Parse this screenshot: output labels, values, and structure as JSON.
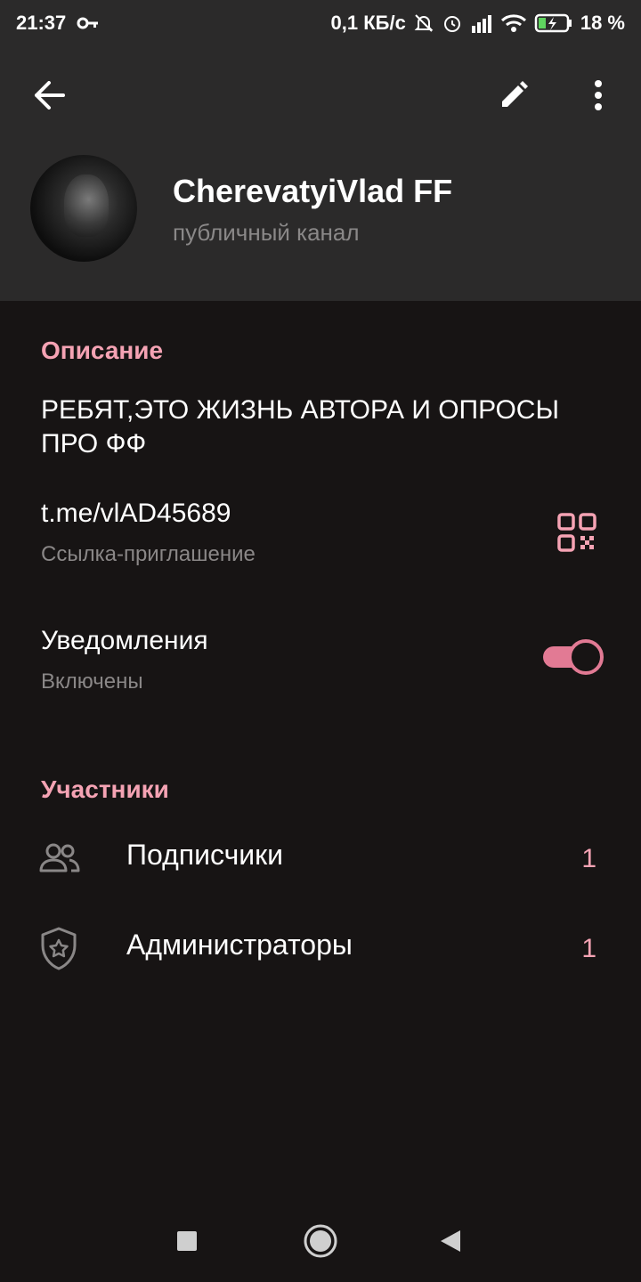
{
  "status_bar": {
    "time": "21:37",
    "speed": "0,1 КБ/с",
    "battery": "18 %",
    "icons": [
      "key-icon",
      "mute-icon",
      "alarm-icon",
      "signal-icon",
      "wifi-icon",
      "battery-icon"
    ]
  },
  "toolbar": {
    "back_icon": "arrow-left-icon",
    "edit_icon": "pencil-icon",
    "more_icon": "more-vertical-icon"
  },
  "channel": {
    "name": "CherevatyiVlad FF",
    "type": "публичный канал"
  },
  "description": {
    "title": "Описание",
    "text": "РЕБЯТ,ЭТО ЖИЗНЬ АВТОРА И ОПРОСЫ ПРО ФФ"
  },
  "invite": {
    "link": "t.me/vlAD45689",
    "label": "Ссылка-приглашение"
  },
  "notifications": {
    "title": "Уведомления",
    "status": "Включены",
    "enabled": true
  },
  "members": {
    "title": "Участники",
    "items": [
      {
        "label": "Подписчики",
        "count": "1",
        "icon": "people-icon"
      },
      {
        "label": "Администраторы",
        "count": "1",
        "icon": "shield-star-icon"
      }
    ]
  },
  "colors": {
    "accent": "#f5a3b4",
    "toggle": "#e27a94",
    "background": "#171414",
    "header": "#2b2a2a"
  }
}
